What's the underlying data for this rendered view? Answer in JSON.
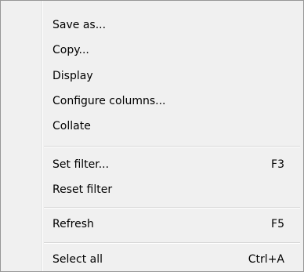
{
  "menu": {
    "items": [
      {
        "label": "Save as...",
        "shortcut": ""
      },
      {
        "label": "Copy...",
        "shortcut": ""
      },
      {
        "label": "Display",
        "shortcut": ""
      },
      {
        "label": "Configure columns...",
        "shortcut": ""
      },
      {
        "label": "Collate",
        "shortcut": ""
      },
      {
        "label": "Set filter...",
        "shortcut": "F3"
      },
      {
        "label": "Reset filter",
        "shortcut": ""
      },
      {
        "label": "Refresh",
        "shortcut": "F5"
      },
      {
        "label": "Select all",
        "shortcut": "Ctrl+A"
      }
    ]
  }
}
